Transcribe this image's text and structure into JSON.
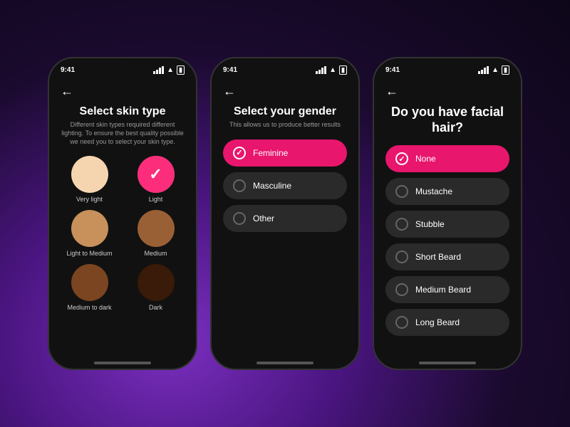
{
  "background": "#0d0618",
  "phones": [
    {
      "id": "skin-type",
      "statusTime": "9:41",
      "title": "Select skin type",
      "subtitle": "Different skin types required different lighting. To ensure the best quality possible we need you to select your skin type.",
      "backLabel": "←",
      "skinOptions": [
        {
          "id": "very-light",
          "label": "Very light",
          "color": "#f5d5b0",
          "selected": false
        },
        {
          "id": "light",
          "label": "Light",
          "color": "#e8b98a",
          "selected": true
        },
        {
          "id": "light-to-medium",
          "label": "Light to Medium",
          "color": "#c8905a",
          "selected": false
        },
        {
          "id": "medium",
          "label": "Medium",
          "color": "#9a6035",
          "selected": false
        },
        {
          "id": "medium-to-dark",
          "label": "Medium to dark",
          "color": "#7a4520",
          "selected": false
        },
        {
          "id": "dark",
          "label": "Dark",
          "color": "#3a1a08",
          "selected": false
        }
      ]
    },
    {
      "id": "gender",
      "statusTime": "9:41",
      "title": "Select your gender",
      "subtitle": "This allows us to produce better results",
      "backLabel": "←",
      "options": [
        {
          "id": "feminine",
          "label": "Feminine",
          "selected": true
        },
        {
          "id": "masculine",
          "label": "Masculine",
          "selected": false
        },
        {
          "id": "other",
          "label": "Other",
          "selected": false
        }
      ]
    },
    {
      "id": "facial-hair",
      "statusTime": "9:41",
      "title": "Do you have facial hair?",
      "subtitle": "",
      "backLabel": "←",
      "options": [
        {
          "id": "none",
          "label": "None",
          "selected": true
        },
        {
          "id": "mustache",
          "label": "Mustache",
          "selected": false
        },
        {
          "id": "stubble",
          "label": "Stubble",
          "selected": false
        },
        {
          "id": "short-beard",
          "label": "Short Beard",
          "selected": false
        },
        {
          "id": "medium-beard",
          "label": "Medium Beard",
          "selected": false
        },
        {
          "id": "long-beard",
          "label": "Long Beard",
          "selected": false
        }
      ]
    }
  ]
}
